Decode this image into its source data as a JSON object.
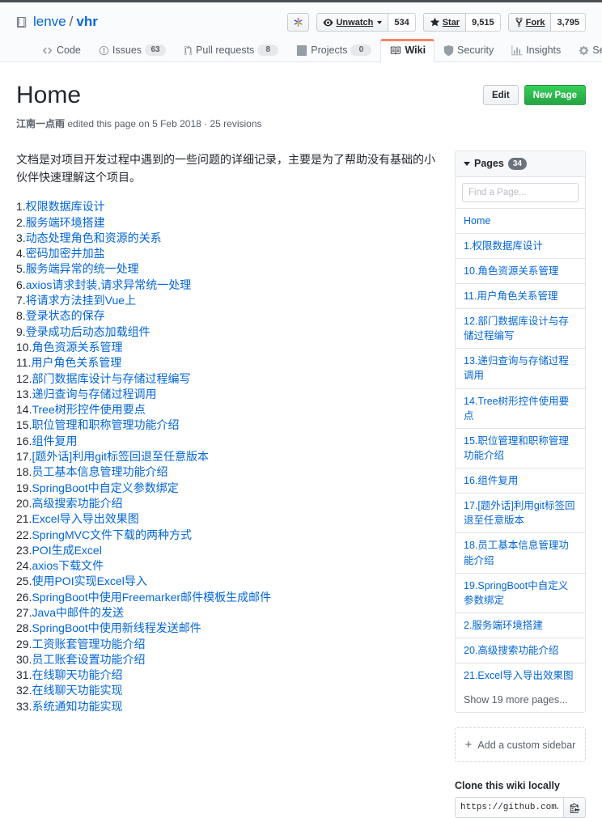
{
  "repo": {
    "owner": "lenve",
    "separator": "/",
    "name": "vhr",
    "repo_icon": "repo-icon"
  },
  "header_actions": {
    "sponsor_icon": "sponsor-heart-icon",
    "watch": {
      "icon": "eye-icon",
      "label": "Unwatch",
      "count": "534"
    },
    "star": {
      "icon": "star-icon",
      "label": "Star",
      "count": "9,515"
    },
    "fork": {
      "icon": "fork-icon",
      "label": "Fork",
      "count": "3,795"
    }
  },
  "nav_tabs": [
    {
      "icon": "code-icon",
      "label": "Code",
      "count": null,
      "selected": false
    },
    {
      "icon": "issue-opened-icon",
      "label": "Issues",
      "count": "63",
      "selected": false
    },
    {
      "icon": "git-pull-request-icon",
      "label": "Pull requests",
      "count": "8",
      "selected": false
    },
    {
      "icon": "project-board-icon",
      "label": "Projects",
      "count": "0",
      "selected": false
    },
    {
      "icon": "book-icon",
      "label": "Wiki",
      "count": null,
      "selected": true
    },
    {
      "icon": "shield-icon",
      "label": "Security",
      "count": null,
      "selected": false
    },
    {
      "icon": "graph-icon",
      "label": "Insights",
      "count": null,
      "selected": false
    },
    {
      "icon": "gear-icon",
      "label": "Settings",
      "count": null,
      "selected": false
    }
  ],
  "wiki": {
    "title": "Home",
    "author": "江南一点雨",
    "byline_rest": " edited this page on 5 Feb 2018 · 25 revisions",
    "edit_label": "Edit",
    "new_page_label": "New Page"
  },
  "content": {
    "intro": "文档是对项目开发过程中遇到的一些问题的详细记录，主要是为了帮助没有基础的小伙伴快速理解这个项目。",
    "items": [
      {
        "num": "1.",
        "label": "权限数据库设计"
      },
      {
        "num": "2.",
        "label": "服务端环境搭建"
      },
      {
        "num": "3.",
        "label": "动态处理角色和资源的关系"
      },
      {
        "num": "4.",
        "label": "密码加密并加盐"
      },
      {
        "num": "5.",
        "label": "服务端异常的统一处理"
      },
      {
        "num": "6.",
        "label": "axios请求封装,请求异常统一处理"
      },
      {
        "num": "7.",
        "label": "将请求方法挂到Vue上"
      },
      {
        "num": "8.",
        "label": "登录状态的保存"
      },
      {
        "num": "9.",
        "label": "登录成功后动态加载组件"
      },
      {
        "num": "10.",
        "label": "角色资源关系管理"
      },
      {
        "num": "11.",
        "label": "用户角色关系管理"
      },
      {
        "num": "12.",
        "label": "部门数据库设计与存储过程编写"
      },
      {
        "num": "13.",
        "label": "递归查询与存储过程调用"
      },
      {
        "num": "14.",
        "label": "Tree树形控件使用要点"
      },
      {
        "num": "15.",
        "label": "职位管理和职称管理功能介绍"
      },
      {
        "num": "16.",
        "label": "组件复用"
      },
      {
        "num": "17.",
        "label": "[题外话]利用git标签回退至任意版本"
      },
      {
        "num": "18.",
        "label": "员工基本信息管理功能介绍"
      },
      {
        "num": "19.",
        "label": "SpringBoot中自定义参数绑定"
      },
      {
        "num": "20.",
        "label": "高级搜索功能介绍"
      },
      {
        "num": "21.",
        "label": "Excel导入导出效果图"
      },
      {
        "num": "22.",
        "label": "SpringMVC文件下载的两种方式"
      },
      {
        "num": "23.",
        "label": "POI生成Excel"
      },
      {
        "num": "24.",
        "label": "axios下载文件"
      },
      {
        "num": "25.",
        "label": "使用POI实现Excel导入"
      },
      {
        "num": "26.",
        "label": "SpringBoot中使用Freemarker邮件模板生成邮件"
      },
      {
        "num": "27.",
        "label": "Java中邮件的发送"
      },
      {
        "num": "28.",
        "label": "SpringBoot中使用新线程发送邮件"
      },
      {
        "num": "29.",
        "label": "工资账套管理功能介绍"
      },
      {
        "num": "30.",
        "label": "员工账套设置功能介绍"
      },
      {
        "num": "31.",
        "label": "在线聊天功能介绍"
      },
      {
        "num": "32.",
        "label": "在线聊天功能实现"
      },
      {
        "num": "33.",
        "label": "系统通知功能实现"
      }
    ]
  },
  "sidebar": {
    "pages_label": "Pages",
    "pages_count": "34",
    "filter_placeholder": "Find a Page...",
    "pages": [
      {
        "label": "Home"
      },
      {
        "label": "1.权限数据库设计"
      },
      {
        "label": "10.角色资源关系管理"
      },
      {
        "label": "11.用户角色关系管理"
      },
      {
        "label": "12.部门数据库设计与存储过程编写"
      },
      {
        "label": "13.递归查询与存储过程调用"
      },
      {
        "label": "14.Tree树形控件使用要点"
      },
      {
        "label": "15.职位管理和职称管理功能介绍"
      },
      {
        "label": "16.组件复用"
      },
      {
        "label": "17.[题外话]利用git标签回退至任意版本"
      },
      {
        "label": "18.员工基本信息管理功能介绍"
      },
      {
        "label": "19.SpringBoot中自定义参数绑定"
      },
      {
        "label": "2.服务端环境搭建"
      },
      {
        "label": "20.高级搜索功能介绍"
      },
      {
        "label": "21.Excel导入导出效果图"
      }
    ],
    "show_more_label": "Show 19 more pages...",
    "add_sidebar_label": "Add a custom sidebar",
    "clone_title": "Clone this wiki locally",
    "clone_url": "https://github.com/lenve/vh",
    "copy_icon": "clipboard-icon"
  },
  "colors": {
    "link": "#0366d6",
    "accent_tab": "#f9826c",
    "green_button": "#28a745",
    "border": "#e1e4e8",
    "muted_text": "#586069"
  }
}
